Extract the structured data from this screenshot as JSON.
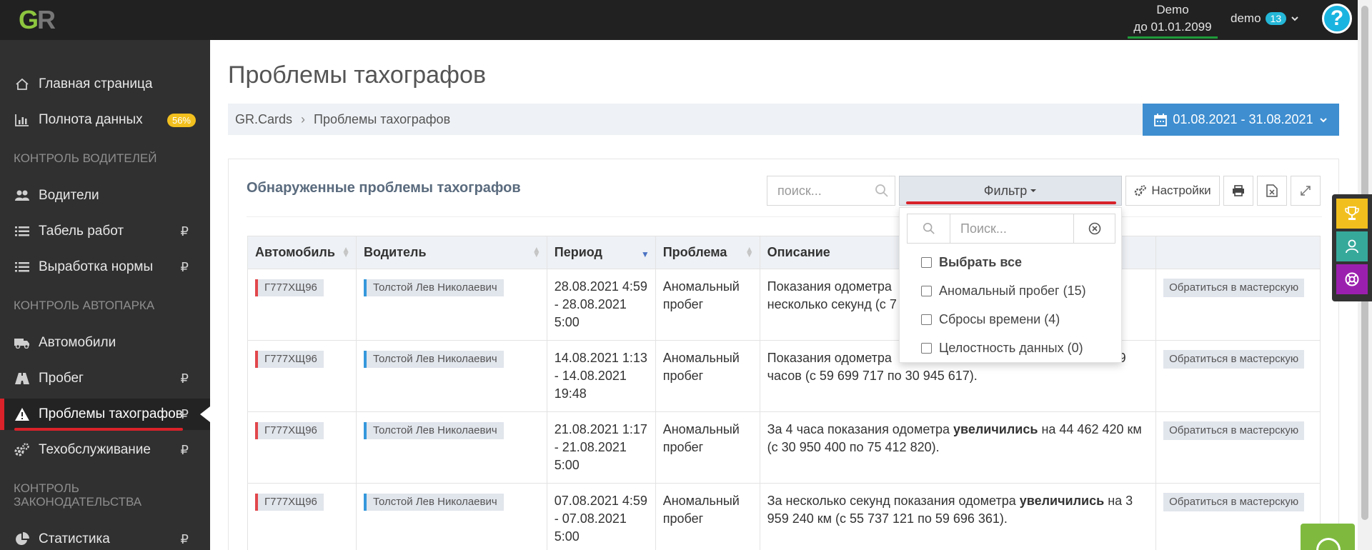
{
  "header": {
    "logo_text": "GR",
    "demo_line1": "Demo",
    "demo_line2": "до 01.01.2099",
    "user_name": "demo",
    "notifications_count": "13",
    "help_label": "?"
  },
  "sidebar": {
    "items": [
      {
        "label": "Главная страница",
        "icon": "home-icon"
      },
      {
        "label": "Полнота данных",
        "icon": "bar-chart-icon",
        "badge": "56%"
      },
      {
        "label": "Водители",
        "icon": "users-icon"
      },
      {
        "label": "Табель работ",
        "icon": "list-icon",
        "rub": "₽"
      },
      {
        "label": "Выработка нормы",
        "icon": "list-icon",
        "rub": "₽"
      },
      {
        "label": "Автомобили",
        "icon": "truck-icon"
      },
      {
        "label": "Пробег",
        "icon": "road-icon",
        "rub": "₽"
      },
      {
        "label": "Проблемы тахографов",
        "icon": "warning-icon",
        "rub": "₽"
      },
      {
        "label": "Техобслуживание",
        "icon": "gears-icon",
        "rub": "₽"
      },
      {
        "label": "Статистика",
        "icon": "pie-chart-icon",
        "rub": "₽"
      }
    ],
    "sections": [
      "Контроль водителей",
      "Контроль автопарка",
      "Контроль законодательства"
    ]
  },
  "main": {
    "page_title": "Проблемы тахографов",
    "breadcrumb": [
      "GR.Cards",
      "Проблемы тахографов"
    ],
    "breadcrumb_sep": "›",
    "date_range": "01.08.2021 - 31.08.2021",
    "portlet_title": "Обнаруженные проблемы тахографов",
    "search_placeholder": "поиск...",
    "filter_label": "Фильтр",
    "settings_label": "Настройки"
  },
  "filter_dropdown": {
    "search_placeholder": "Поиск...",
    "select_all": "Выбрать все",
    "options": [
      "Аномальный пробег (15)",
      "Сбросы времени (4)",
      "Целостность данных (0)"
    ]
  },
  "table": {
    "columns": [
      "Автомобиль",
      "Водитель",
      "Период",
      "Проблема",
      "Описание",
      ""
    ],
    "rows": [
      {
        "car": "Г777ХЩ96",
        "driver": "Толстой Лев Николаевич",
        "period": "28.08.2021 4:59 - 28.08.2021 5:00",
        "problem": "Аномальный пробег",
        "desc_pre": "Показания одометра",
        "desc_bold": "",
        "desc_post": "несколько секунд (с 7",
        "action": "Обратиться в мастерскую"
      },
      {
        "car": "Г777ХЩ96",
        "driver": "Толстой Лев Николаевич",
        "period": "14.08.2021 1:13 - 14.08.2021 19:48",
        "problem": "Аномальный пробег",
        "desc_pre": "Показания одометра",
        "desc_bold": "",
        "desc_post": "часов (с 59 699 717 по 30 945 617).",
        "action": "Обратиться в мастерскую"
      },
      {
        "car": "Г777ХЩ96",
        "driver": "Толстой Лев Николаевич",
        "period": "21.08.2021 1:17 - 21.08.2021 5:00",
        "problem": "Аномальный пробег",
        "desc_pre": "За 4 часа показания одометра ",
        "desc_bold": "увеличились",
        "desc_post": " на 44 462 420 км (с 30 950 400 по 75 412 820).",
        "action": "Обратиться в мастерскую"
      },
      {
        "car": "Г777ХЩ96",
        "driver": "Толстой Лев Николаевич",
        "period": "07.08.2021 4:59 - 07.08.2021 5:00",
        "problem": "Аномальный пробег",
        "desc_pre": "За несколько секунд показания одометра ",
        "desc_bold": "увеличились",
        "desc_post": " на 3 959 240 км (с 55 737 121 по 59 696 361).",
        "action": "Обратиться в мастерскую"
      }
    ],
    "row1_extra": "9"
  },
  "colors": {
    "accent_red": "#d9222a",
    "date_button": "#3e8ed0",
    "badge_yellow": "#f2c01e",
    "badge_cyan": "#24b7d8"
  }
}
